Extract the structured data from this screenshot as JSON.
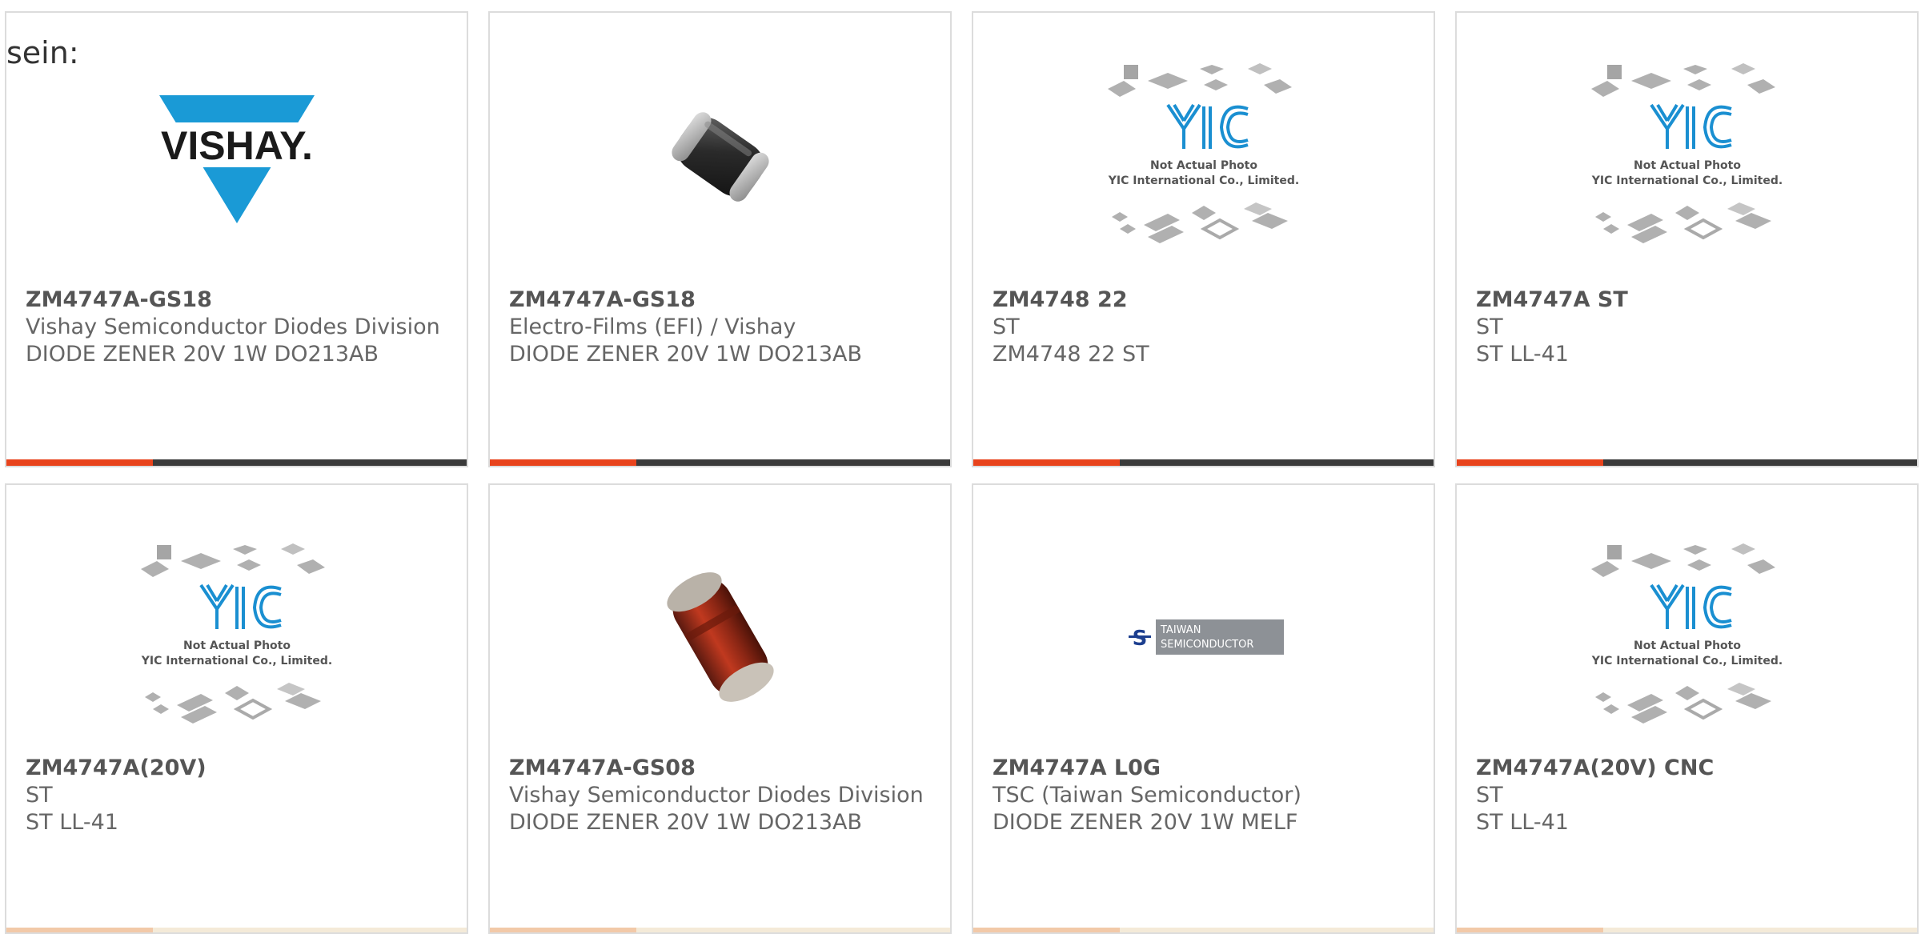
{
  "intro_text": "sein:",
  "colors": {
    "accent": "#e8431c",
    "bar_dark": "#3a3a3a",
    "vishay_blue": "#1a9ad6",
    "yic_blue": "#1a8fd1"
  },
  "cards": [
    {
      "image": "vishay-logo",
      "logo_text": "VISHAY.",
      "part_number": "ZM4747A-GS18",
      "manufacturer": "Vishay Semiconductor Diodes Division",
      "description": "DIODE ZENER 20V 1W DO213AB"
    },
    {
      "image": "black-melf-diode-photo",
      "part_number": "ZM4747A-GS18",
      "manufacturer": "Electro-Films (EFI) / Vishay",
      "description": "DIODE ZENER 20V 1W DO213AB"
    },
    {
      "image": "yic-placeholder",
      "placeholder_line1": "Not Actual Photo",
      "placeholder_line2": "YIC International Co., Limited.",
      "part_number": "ZM4748 22",
      "manufacturer": "ST",
      "description": "ZM4748 22 ST"
    },
    {
      "image": "yic-placeholder",
      "placeholder_line1": "Not Actual Photo",
      "placeholder_line2": "YIC International Co., Limited.",
      "part_number": "ZM4747A ST",
      "manufacturer": "ST",
      "description": "ST LL-41"
    },
    {
      "image": "yic-placeholder",
      "placeholder_line1": "Not Actual Photo",
      "placeholder_line2": "YIC International Co., Limited.",
      "part_number": "ZM4747A(20V)",
      "manufacturer": "ST",
      "description": "ST LL-41"
    },
    {
      "image": "red-melf-diode-photo",
      "part_number": "ZM4747A-GS08",
      "manufacturer": "Vishay Semiconductor Diodes Division",
      "description": "DIODE ZENER 20V 1W DO213AB"
    },
    {
      "image": "taiwan-semiconductor-logo",
      "logo_line1": "TAIWAN",
      "logo_line2": "SEMICONDUCTOR",
      "part_number": "ZM4747A L0G",
      "manufacturer": "TSC (Taiwan Semiconductor)",
      "description": "DIODE ZENER 20V 1W MELF"
    },
    {
      "image": "yic-placeholder",
      "placeholder_line1": "Not Actual Photo",
      "placeholder_line2": "YIC International Co., Limited.",
      "part_number": "ZM4747A(20V) CNC",
      "manufacturer": "ST",
      "description": "ST LL-41"
    }
  ]
}
